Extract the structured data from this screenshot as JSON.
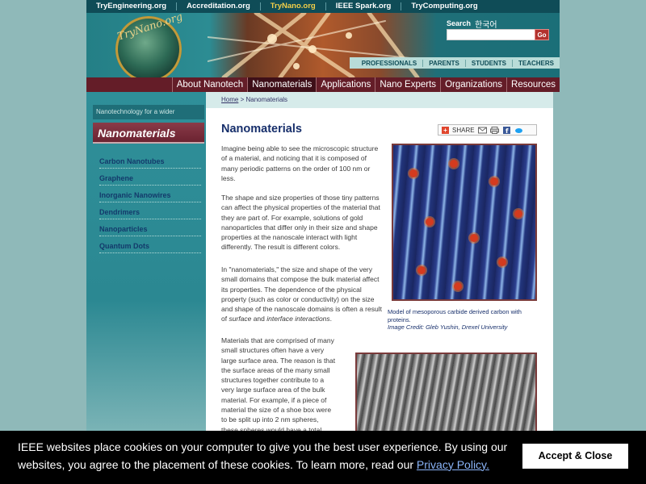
{
  "top_nav": {
    "links": [
      {
        "label": "TryEngineering.org",
        "active": false
      },
      {
        "label": "Accreditation.org",
        "active": false
      },
      {
        "label": "TryNano.org",
        "active": true
      },
      {
        "label": "IEEE Spark.org",
        "active": false
      },
      {
        "label": "TryComputing.org",
        "active": false
      }
    ]
  },
  "header": {
    "logo_text": "TryNano.org",
    "search_label": "Search",
    "korean_link": "한국어",
    "search_value": "",
    "go_label": "Go",
    "audience_links": [
      "PROFESSIONALS",
      "PARENTS",
      "STUDENTS",
      "TEACHERS"
    ]
  },
  "main_nav": {
    "items": [
      {
        "label": "About Nanotech",
        "active": false
      },
      {
        "label": "Nanomaterials",
        "active": true
      },
      {
        "label": "Applications",
        "active": false
      },
      {
        "label": "Nano Experts",
        "active": false
      },
      {
        "label": "Organizations",
        "active": false
      },
      {
        "label": "Resources",
        "active": false
      }
    ]
  },
  "sidebar": {
    "tagline": "Nanotechnology for a wider audience.",
    "section_title": "Nanomaterials",
    "items": [
      "Carbon Nanotubes",
      "Graphene",
      "Inorganic Nanowires",
      "Dendrimers",
      "Nanoparticles",
      "Quantum Dots"
    ]
  },
  "content": {
    "breadcrumb_home": "Home",
    "breadcrumb_separator": " > ",
    "breadcrumb_current": "Nanomaterials",
    "title": "Nanomaterials",
    "share_label": "SHARE",
    "paragraphs": {
      "p1": "Imagine being able to see the microscopic structure of a material, and noticing that it is composed of many periodic patterns on the order of 100 nm or less.",
      "p2": "The shape and size properties of those tiny patterns can affect the physical properties of the material that they are part of.  For example, solutions of gold nanoparticles that differ only in their size and shape properties at the nanoscale interact with light differently.  The result is different colors.",
      "p3_start": "In \"nanomaterials,\" the size and shape of the very small domains that compose the bulk material affect its properties. The dependence of the physical property (such as color or conductivity) on the size and shape of the nanoscale domains is often a result of ",
      "p3_em1": "surface",
      "p3_mid": " and ",
      "p3_em2": "interface interactions",
      "p3_end": ".",
      "p4": "Materials that are comprised of many small structures often have a very large surface area.  The reason is that the surface areas of the many small structures together contribute to a very large surface area of the bulk material. For example, if a piece of material the size of a shoe box were to be split up into 2 nm spheres, these spheres would have a total surface area"
    },
    "caption1": "Model of mesoporous carbide derived carbon with proteins.",
    "credit1": "Image Credit: Gleb Yushin, Drexel University"
  },
  "cookie": {
    "text": "IEEE websites place cookies on your computer to give you the best user experience. By using our websites, you agree to the placement of these cookies. To learn more, read our ",
    "link": "Privacy Policy.",
    "accept_label": "Accept & Close"
  },
  "colors": {
    "top_nav_bg": "#0f4c57",
    "main_nav_bg": "#641d28",
    "title_blue": "#172f6b",
    "page_bg": "#8fb9b9",
    "active_yellow": "#f3cf48"
  }
}
